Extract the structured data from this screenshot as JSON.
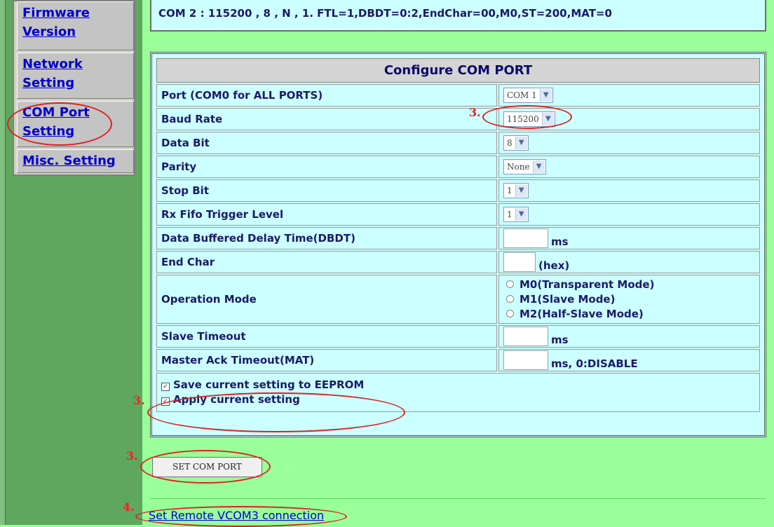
{
  "sidebar": {
    "items": [
      {
        "label_1": "Firmware",
        "label_2": "Version"
      },
      {
        "label_1": "Network",
        "label_2": "Setting"
      },
      {
        "label_1": "COM Port",
        "label_2": "Setting"
      },
      {
        "label_1": "Misc. Setting"
      }
    ]
  },
  "status_text": "COM 2 : 115200 , 8 , N , 1. FTL=1,DBDT=0:2,EndChar=00,M0,ST=200,MAT=0",
  "config": {
    "title": "Configure COM PORT",
    "rows": {
      "port": {
        "label": "Port (COM0 for ALL PORTS)",
        "value": "COM 1"
      },
      "baud": {
        "label": "Baud Rate",
        "value": "115200"
      },
      "databit": {
        "label": "Data Bit",
        "value": "8"
      },
      "parity": {
        "label": "Parity",
        "value": "None"
      },
      "stopbit": {
        "label": "Stop Bit",
        "value": "1"
      },
      "rxfifo": {
        "label": "Rx Fifo Trigger Level",
        "value": "1"
      },
      "dbdt": {
        "label": "Data Buffered Delay Time(DBDT)",
        "unit": "ms"
      },
      "endchar": {
        "label": "End Char",
        "unit": "(hex)"
      },
      "opmode": {
        "label": "Operation Mode",
        "options": [
          "M0(Transparent Mode)",
          "M1(Slave Mode)",
          "M2(Half-Slave Mode)"
        ]
      },
      "slavetimeout": {
        "label": "Slave Timeout",
        "unit": "ms"
      },
      "mat": {
        "label": "Master Ack Timeout(MAT)",
        "unit": "ms, 0:DISABLE"
      }
    },
    "checkboxes": [
      "Save current setting to EEPROM",
      "Apply current setting"
    ]
  },
  "set_button": "SET COM PORT",
  "remote_link": "Set Remote VCOM3 connection",
  "annotations": [
    "3.",
    "3.",
    "3.",
    "4."
  ],
  "colors": {
    "background": "#99ff99",
    "panel": "#ccffff",
    "link": "#0000cc",
    "annotation": "#dd2020"
  }
}
